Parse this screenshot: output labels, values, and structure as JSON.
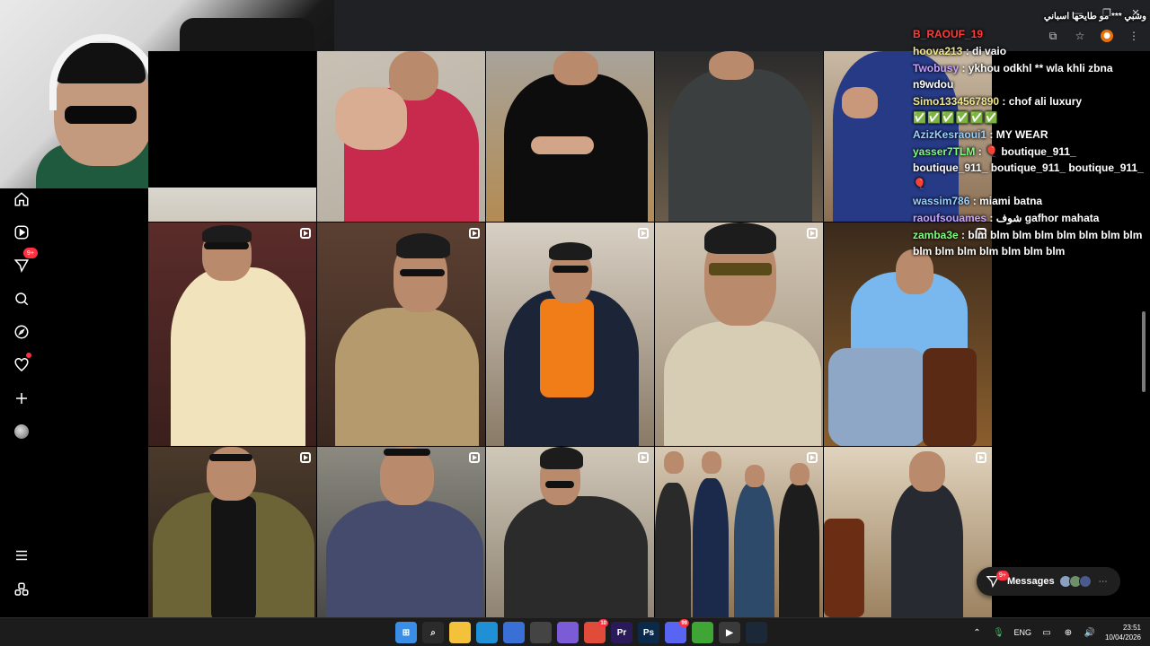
{
  "chat": [
    {
      "user": "",
      "message": "وشبي *** مو طايحها اسباني",
      "color": "#ffffff"
    },
    {
      "user": "B_RAOUF_19",
      "message": "",
      "color": "#ff3b3b"
    },
    {
      "user": "hoova213",
      "message": "di vaio",
      "color": "#f0e68c"
    },
    {
      "user": "Twobusy",
      "message": "ykhou odkhl ** wla khli zbna n9wdou",
      "color": "#c8a2ff"
    },
    {
      "user": "Simo1334567890",
      "message": "chof ali luxury",
      "color": "#f0e68c",
      "extra": "✅✅✅✅✅✅"
    },
    {
      "user": "AzizKesraoui1",
      "message": "MY WEAR",
      "color": "#9ad0ff"
    },
    {
      "user": "yasser7TLM",
      "message": "🎈 boutique_911_ boutique_911_ boutique_911_ boutique_911_ 🎈",
      "color": "#7dff7d"
    },
    {
      "user": "wassim786",
      "message": "miami batna",
      "color": "#9ad0ff"
    },
    {
      "user": "raoufsouames",
      "message": "شوف gafhor mahata",
      "color": "#c8a2ff"
    },
    {
      "user": "zamba3e",
      "message": "blm blm blm blm blm blm blm blm blm blm blm blm blm blm blm",
      "color": "#7dff7d"
    }
  ],
  "nav": {
    "notifications_badge": "9+",
    "items": [
      "home",
      "reels",
      "messages",
      "search",
      "explore",
      "notifications",
      "create",
      "profile"
    ],
    "bottom": [
      "more",
      "meta"
    ]
  },
  "messages_pill": {
    "label": "Messages",
    "badge": "9+"
  },
  "taskbar": {
    "language": "ENG",
    "time": "23:51",
    "date": "10/04/2026",
    "icons": [
      {
        "name": "windows-start",
        "label": "⊞",
        "color": "#3a8ee6"
      },
      {
        "name": "search",
        "label": "⌕",
        "color": "#2b2b2b"
      },
      {
        "name": "file-explorer",
        "label": "",
        "color": "#f3c13a"
      },
      {
        "name": "edge",
        "label": "",
        "color": "#1f8fd6"
      },
      {
        "name": "store",
        "label": "",
        "color": "#3a6fd6"
      },
      {
        "name": "obs",
        "label": "",
        "color": "#444"
      },
      {
        "name": "chat-app",
        "label": "",
        "color": "#7b5bd6"
      },
      {
        "name": "chrome",
        "label": "",
        "color": "#e04b3a",
        "badge": "10"
      },
      {
        "name": "premiere",
        "label": "Pr",
        "color": "#2a1a5a"
      },
      {
        "name": "photoshop",
        "label": "Ps",
        "color": "#0b2a4a"
      },
      {
        "name": "discord",
        "label": "",
        "color": "#5865f2",
        "badge": "99"
      },
      {
        "name": "xbox",
        "label": "",
        "color": "#3fa535"
      },
      {
        "name": "media-player",
        "label": "▶",
        "color": "#3a3a3a"
      },
      {
        "name": "steam",
        "label": "",
        "color": "#1b2838"
      }
    ]
  }
}
